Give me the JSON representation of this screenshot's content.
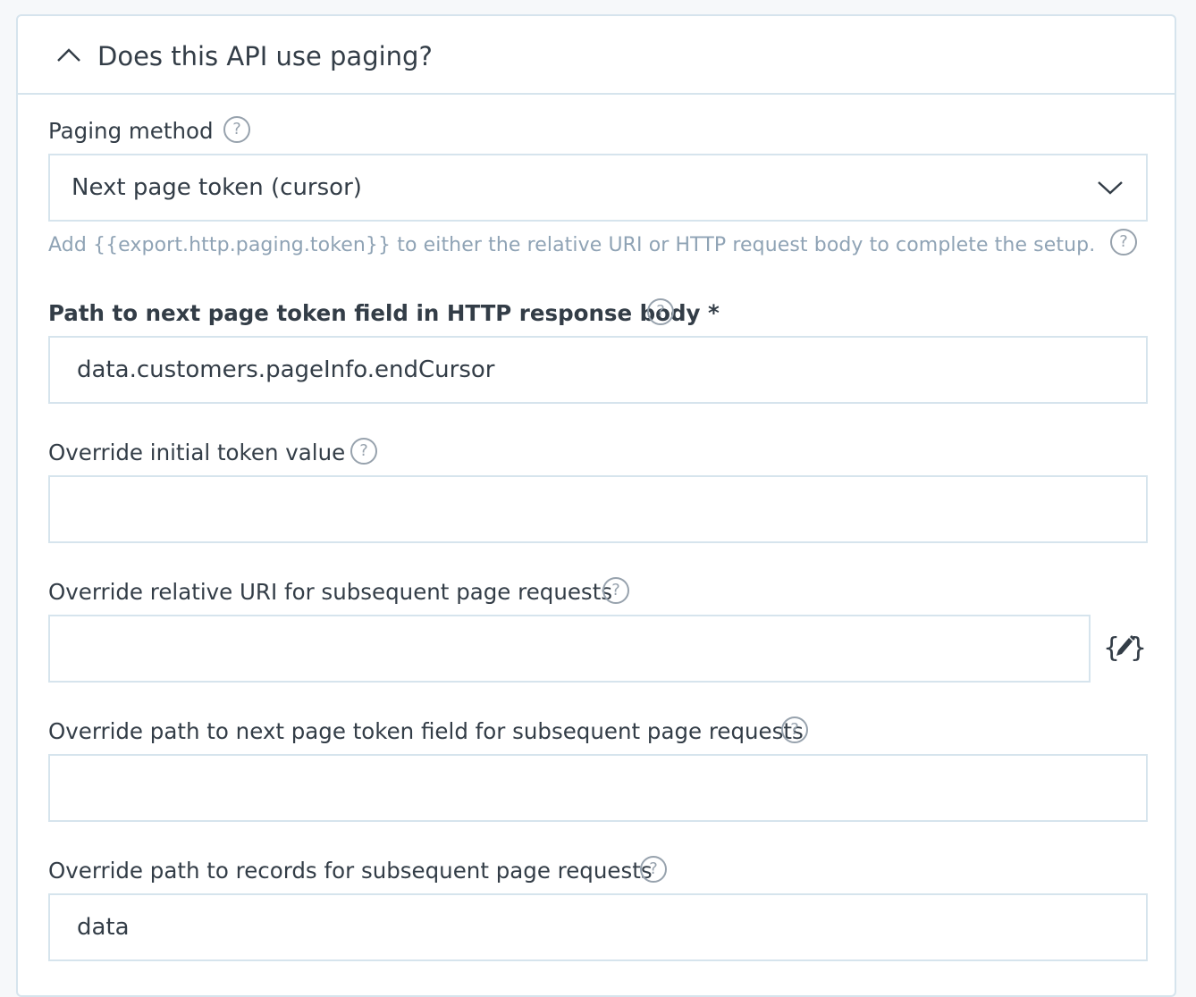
{
  "section": {
    "title": "Does this API use paging?",
    "expanded": true
  },
  "paging_method": {
    "label": "Paging method",
    "value": "Next page token (cursor)",
    "hint": "Add {{export.http.paging.token}} to either the relative URI or HTTP request body to complete the setup."
  },
  "token_path": {
    "label": "Path to next page token field in HTTP response body *",
    "value": "data.customers.pageInfo.endCursor"
  },
  "initial_token": {
    "label": "Override initial token value",
    "value": ""
  },
  "relative_uri": {
    "label": "Override relative URI for subsequent page requests",
    "value": ""
  },
  "subsequent_token_path": {
    "label": "Override path to next page token field for subsequent page requests",
    "value": ""
  },
  "records_path": {
    "label": "Override path to records for subsequent page requests",
    "value": "data"
  },
  "help_glyph": "?",
  "icons": {
    "collapse": "chevron-up-icon",
    "dropdown": "chevron-down-icon",
    "help": "question-circle-icon",
    "editor": "handlebars-editor-icon"
  },
  "colors": {
    "border": "#d6e4ed",
    "text": "#333d47",
    "hint": "#8fa3b5",
    "icon": "#97a2ad"
  }
}
